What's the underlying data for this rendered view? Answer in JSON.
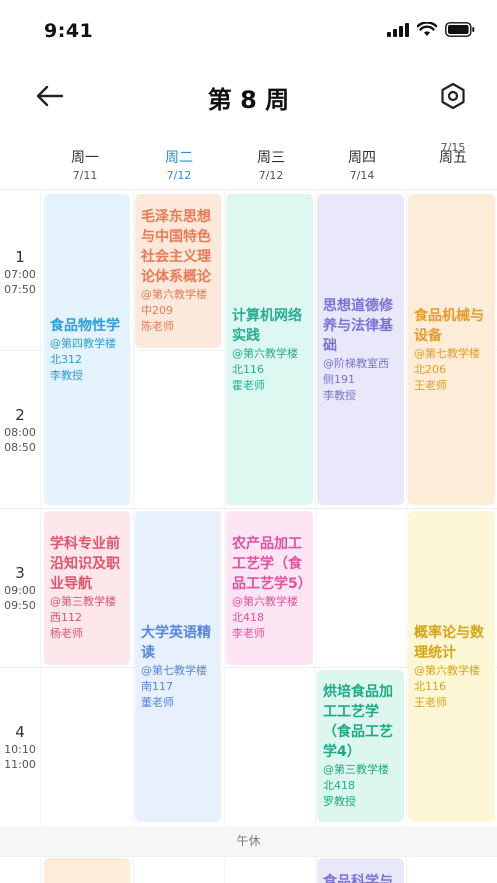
{
  "status": {
    "time": "9:41"
  },
  "header": {
    "title": "第 8 周",
    "back_icon": "arrow-left-icon",
    "settings_icon": "hexagon-settings-icon"
  },
  "days": [
    {
      "name": "周一",
      "date": "7/11"
    },
    {
      "name": "周二",
      "date": "7/12"
    },
    {
      "name": "周三",
      "date": "7/12"
    },
    {
      "name": "周四",
      "date": "7/14"
    },
    {
      "name": "周五",
      "date": "7/15"
    }
  ],
  "periods": [
    {
      "num": "1",
      "start": "07:00",
      "end": "07:50"
    },
    {
      "num": "2",
      "start": "08:00",
      "end": "08:50"
    },
    {
      "num": "3",
      "start": "09:00",
      "end": "09:50"
    },
    {
      "num": "4",
      "start": "10:10",
      "end": "11:00"
    }
  ],
  "lunch_label": "午休",
  "courses": [
    {
      "name": "食品物性学",
      "room": "@第四教学楼北312",
      "teacher": "李教授"
    },
    {
      "name": "毛泽东思想与中国特色社会主义理论体系概论",
      "room": "@第六教学楼中209",
      "teacher": "陈老师"
    },
    {
      "name": "计算机网络实践",
      "room": "@第六教学楼北116",
      "teacher": "霍老师"
    },
    {
      "name": "思想道德修养与法律基础",
      "room": "@阶梯教室西侧191",
      "teacher": "李教授"
    },
    {
      "name": "食品机械与设备",
      "room": "@第七教学楼北206",
      "teacher": "王老师"
    },
    {
      "name": "学科专业前沿知识及职业导航",
      "room": "@第三教学楼西112",
      "teacher": "杨老师"
    },
    {
      "name": "大学英语精读",
      "room": "@第七教学楼南117",
      "teacher": "董老师"
    },
    {
      "name": "农产品加工工艺学（食品工艺学5）",
      "room": "@第六教学楼北418",
      "teacher": "李老师"
    },
    {
      "name": "概率论与数理统计",
      "room": "@第六教学楼北116",
      "teacher": "王老师"
    },
    {
      "name": "烘培食品加工工艺学（食品工艺学4）",
      "room": "@第三教学楼北418",
      "teacher": "罗教授"
    },
    {
      "name": "食品科学与",
      "room": "",
      "teacher": ""
    }
  ]
}
